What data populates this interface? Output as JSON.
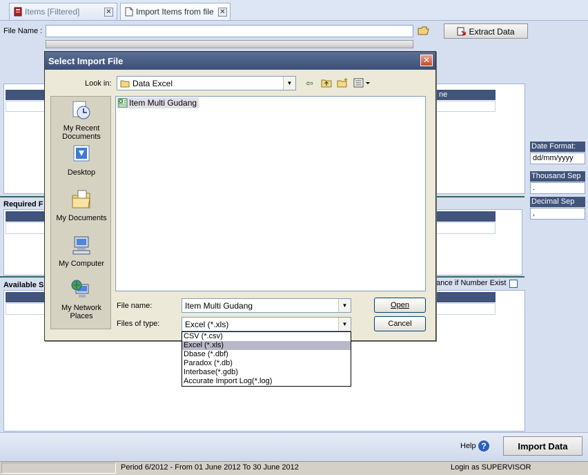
{
  "tabs": [
    {
      "label": "Items [Filtered]",
      "state": "inactive"
    },
    {
      "label": "Import Items from file",
      "state": "active"
    }
  ],
  "form": {
    "file_name_label": "File Name :",
    "file_name_value": "",
    "extract_button": "Extract Data"
  },
  "sections": {
    "required_label": "Required F",
    "available_label": "Available S",
    "column_header_fragment": "ne",
    "balance_label": "ance if Number Exist"
  },
  "format": {
    "date_label": "Date Format:",
    "date_value": "dd/mm/yyyy",
    "thousand_label": "Thousand Sep",
    "thousand_value": ".",
    "decimal_label": "Decimal Sep",
    "decimal_value": ","
  },
  "dialog": {
    "title": "Select Import File",
    "look_in_label": "Look in:",
    "look_in_value": "Data Excel",
    "places": [
      {
        "label": "My Recent Documents",
        "icon": "recent-documents-icon"
      },
      {
        "label": "Desktop",
        "icon": "desktop-icon"
      },
      {
        "label": "My Documents",
        "icon": "my-documents-icon"
      },
      {
        "label": "My Computer",
        "icon": "my-computer-icon"
      },
      {
        "label": "My Network Places",
        "icon": "network-places-icon"
      }
    ],
    "files": [
      {
        "name": "Item Multi Gudang",
        "icon": "excel-file-icon"
      }
    ],
    "file_name_label": "File name:",
    "file_name_value": "Item Multi Gudang",
    "files_of_type_label": "Files of type:",
    "files_of_type_value": "Excel (*.xls)",
    "open_button": "Open",
    "cancel_button": "Cancel",
    "type_options": [
      "CSV (*.csv)",
      "Excel (*.xls)",
      "Dbase (*.dbf)",
      "Paradox (*.db)",
      "Interbase(*.gdb)",
      "Accurate Import Log(*.log)"
    ],
    "selected_type_index": 1
  },
  "footer": {
    "help_label": "Help",
    "import_button": "Import Data"
  },
  "status": {
    "period": "Period 6/2012 - From 01 June 2012 To 30 June 2012",
    "login": "Login as SUPERVISOR"
  }
}
